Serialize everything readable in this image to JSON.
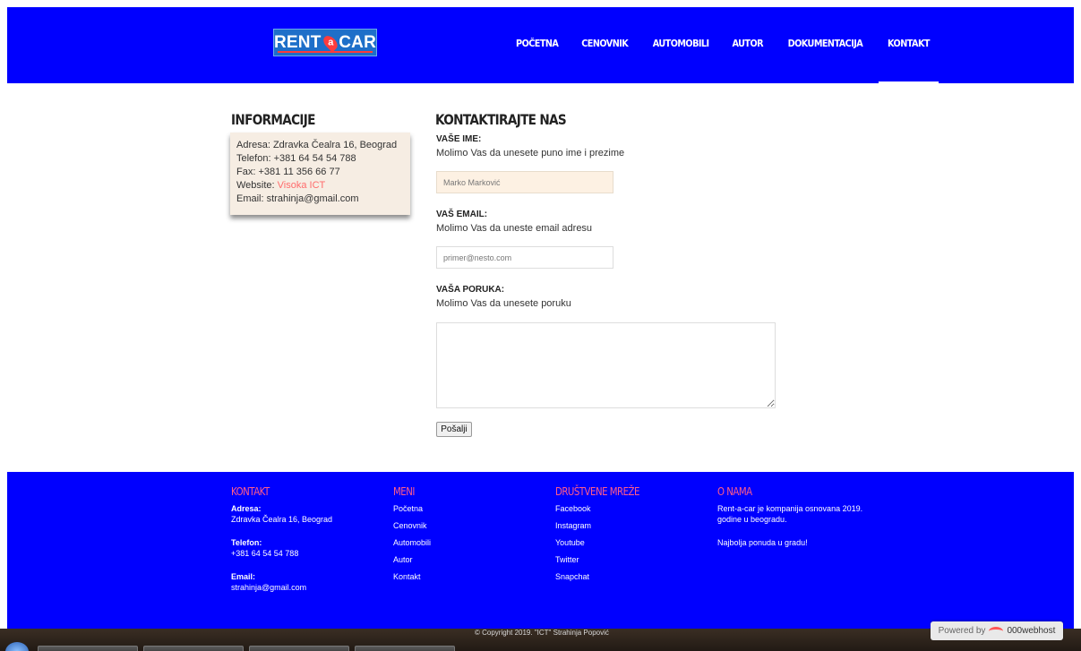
{
  "header": {
    "logo": {
      "left": "RENT",
      "pin": "a",
      "right": "CAR"
    },
    "nav": [
      {
        "label": "POČETNA",
        "active": false
      },
      {
        "label": "CENOVNIK",
        "active": false
      },
      {
        "label": "AUTOMOBILI",
        "active": false
      },
      {
        "label": "AUTOR",
        "active": false
      },
      {
        "label": "DOKUMENTACIJA",
        "active": false
      },
      {
        "label": "KONTAKT",
        "active": true
      }
    ]
  },
  "info": {
    "title": "INFORMACIJE",
    "address": "Adresa: Zdravka Čealra 16, Beograd",
    "phone": "Telefon: +381 64 54 54 788",
    "fax": "Fax: +381 11 356 66 77",
    "website_label": "Website: ",
    "website_link": "Visoka ICT",
    "email": "Email: strahinja@gmail.com"
  },
  "form": {
    "title": "KONTAKTIRAJTE NAS",
    "name_label": "VAŠE IME:",
    "name_hint": "Molimo Vas da unesete puno ime i prezime",
    "name_placeholder": "Marko Marković",
    "email_label": "VAŠ EMAIL:",
    "email_hint": "Molimo Vas da uneste email adresu",
    "email_placeholder": "primer@nesto.com",
    "message_label": "VAŠA PORUKA:",
    "message_hint": "Molimo Vas da unesete poruku",
    "submit": "Pošalji"
  },
  "footer": {
    "contact": {
      "title": "KONTAKT",
      "address_label": "Adresa:",
      "address": "Zdravka Čealra 16, Beograd",
      "phone_label": "Telefon:",
      "phone": "+381 64 54 54 788",
      "email_label": "Email:",
      "email": "strahinja@gmail.com"
    },
    "menu": {
      "title": "MENI",
      "items": [
        "Početna",
        "Cenovnik",
        "Automobili",
        "Autor",
        "Kontakt"
      ]
    },
    "social": {
      "title": "DRUŠTVENE MREŽE",
      "items": [
        "Facebook",
        "Instagram",
        "Youtube",
        "Twitter",
        "Snapchat"
      ]
    },
    "about": {
      "title": "O NAMA",
      "text1": "Rent-a-car je kompanija osnovana 2019. godine u beogradu.",
      "text2": "Najbolja ponuda u gradu!"
    },
    "copyright": "© Copyright 2019. \"ICT\" Strahinja Popović",
    "powered_prefix": "Powered by",
    "powered_brand": "000webhost"
  },
  "colors": {
    "primary": "#0000ff",
    "accent": "#ff5c8a",
    "info_bg": "#f6ede3",
    "link": "#ff6b6b"
  }
}
